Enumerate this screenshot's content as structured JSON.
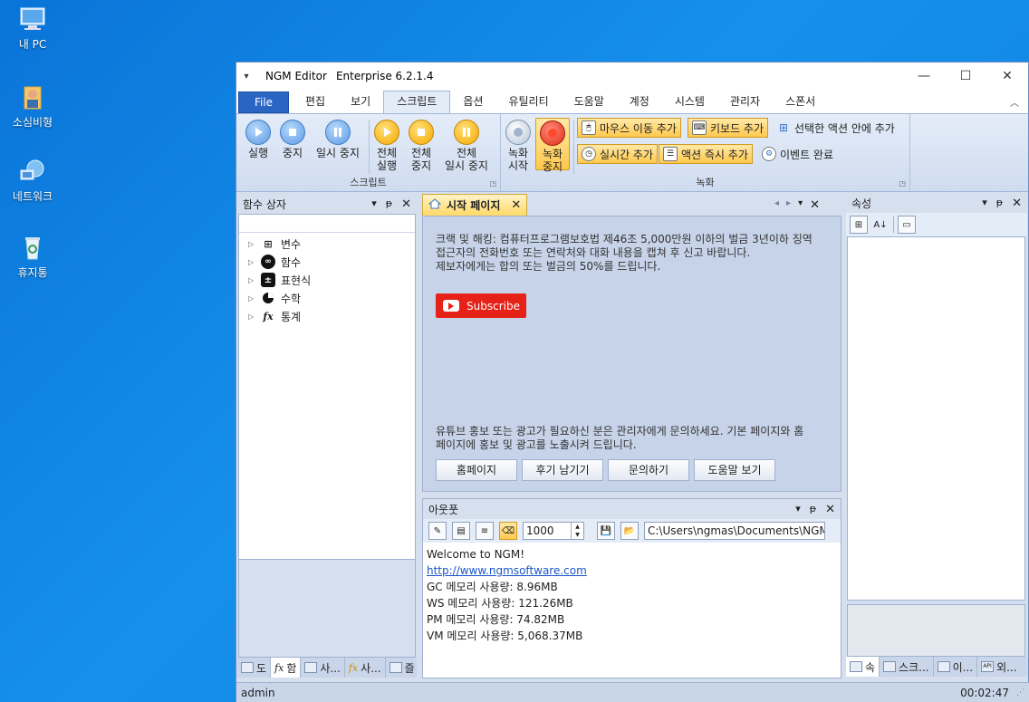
{
  "desktop": {
    "icons": [
      {
        "label": "내 PC",
        "icon": "pc-icon"
      },
      {
        "label": "소심비형",
        "icon": "user-folder-icon"
      },
      {
        "label": "네트워크",
        "icon": "network-icon"
      },
      {
        "label": "휴지통",
        "icon": "recycle-bin-icon"
      }
    ]
  },
  "window": {
    "app_name": "NGM Editor",
    "edition": "Enterprise 6.2.1.4"
  },
  "menu": {
    "tabs": [
      "File",
      "편집",
      "보기",
      "스크립트",
      "옵션",
      "유틸리티",
      "도움말",
      "계정",
      "시스템",
      "관리자",
      "스폰서"
    ],
    "active": "스크립트"
  },
  "ribbon": {
    "script_group": {
      "label": "스크립트",
      "buttons": [
        {
          "line1": "실행",
          "line2": ""
        },
        {
          "line1": "중지",
          "line2": ""
        },
        {
          "line1": "일시 중지",
          "line2": ""
        },
        {
          "line1": "전체",
          "line2": "실행"
        },
        {
          "line1": "전체",
          "line2": "중지"
        },
        {
          "line1": "전체",
          "line2": "일시 중지"
        }
      ]
    },
    "record_group": {
      "label": "녹화",
      "buttons": [
        {
          "line1": "녹화",
          "line2": "시작"
        },
        {
          "line1": "녹화",
          "line2": "중지"
        }
      ],
      "small": [
        "마우스 이동 추가",
        "키보드 추가",
        "선택한 액션 안에 추가",
        "실시간 추가",
        "액션 즉시 추가",
        "이벤트 완료"
      ]
    }
  },
  "function_box": {
    "title": "함수 상자",
    "items": [
      "변수",
      "함수",
      "표현식",
      "수학",
      "통계"
    ],
    "bottom_tabs": [
      "도",
      "함",
      "사...",
      "사...",
      "즐"
    ]
  },
  "start_page": {
    "tab_label": "시작 페이지",
    "notice": [
      "크랙 및 해킹: 컴퓨터프로그램보호법 제46조 5,000만원 이하의 벌금 3년이하 징역",
      "접근자의 전화번호 또는 연락처와 대화 내용을 캡쳐 후 신고 바랍니다.",
      "제보자에게는 합의 또는 벌금의 50%를 드립니다."
    ],
    "subscribe": "Subscribe",
    "promo": [
      "유튜브 홍보 또는 광고가 필요하신 분은 관리자에게 문의하세요. 기본 페이지와 홈",
      "페이지에 홍보 및 광고를 노출시켜 드립니다."
    ],
    "buttons": [
      "홈페이지",
      "후기 남기기",
      "문의하기",
      "도움말 보기"
    ]
  },
  "output": {
    "title": "아웃풋",
    "count": "1000",
    "path": "C:\\Users\\ngmas\\Documents\\NGM6\\",
    "lines": [
      {
        "text": "Welcome to NGM!",
        "link": false
      },
      {
        "text": "http://www.ngmsoftware.com",
        "link": true
      },
      {
        "text": "GC 메모리 사용량: 8.96MB",
        "link": false
      },
      {
        "text": "WS 메모리 사용량: 121.26MB",
        "link": false
      },
      {
        "text": "PM 메모리 사용량: 74.82MB",
        "link": false
      },
      {
        "text": "VM 메모리 사용량: 5,068.37MB",
        "link": false
      }
    ]
  },
  "properties": {
    "title": "속성",
    "bottom_tabs": [
      "속",
      "스크...",
      "이...",
      "외..."
    ]
  },
  "status": {
    "user": "admin",
    "time": "00:02:47"
  }
}
